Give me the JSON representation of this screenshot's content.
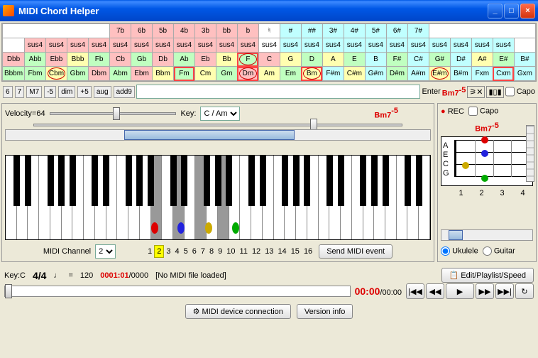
{
  "window": {
    "title": "MIDI Chord Helper"
  },
  "accidentals": [
    "7b",
    "6b",
    "5b",
    "4b",
    "3b",
    "bb",
    "b",
    "♮",
    "#",
    "##",
    "3#",
    "4#",
    "5#",
    "6#",
    "7#"
  ],
  "sus4_row": [
    "sus4",
    "sus4",
    "sus4",
    "sus4",
    "sus4",
    "sus4",
    "sus4",
    "sus4",
    "sus4",
    "sus4",
    "sus4",
    "sus4",
    "sus4",
    "sus4",
    "sus4",
    "sus4",
    "sus4",
    "sus4",
    "sus4",
    "sus4",
    "sus4",
    "sus4",
    "sus4"
  ],
  "major_row": [
    "Dbb",
    "Abb",
    "Ebb",
    "Bbb",
    "Fb",
    "Cb",
    "Gb",
    "Db",
    "Ab",
    "Eb",
    "Bb",
    "F",
    "C",
    "G",
    "D",
    "A",
    "E",
    "B",
    "F#",
    "C#",
    "G#",
    "D#",
    "A#",
    "E#",
    "B#"
  ],
  "minor_row": [
    "Bbbm",
    "Fbm",
    "Cbm",
    "Gbm",
    "Dbm",
    "Abm",
    "Ebm",
    "Bbm",
    "Fm",
    "Cm",
    "Gm",
    "Dm",
    "Am",
    "Em",
    "Bm",
    "F#m",
    "C#m",
    "G#m",
    "D#m",
    "A#m",
    "E#m",
    "B#m",
    "Fxm",
    "Cxm",
    "Gxm"
  ],
  "suffixes": [
    "6",
    "7",
    "M7",
    "-5",
    "dim",
    "+5",
    "aug",
    "add9"
  ],
  "enter_label": "Enter",
  "chord_display": "Bm7",
  "chord_sup": "-5",
  "capo_label": "Capo",
  "velocity": {
    "label": "Velocity=64"
  },
  "key": {
    "label": "Key:",
    "value": "C / Am"
  },
  "rec_label": "REC",
  "fret": {
    "strings": [
      "A",
      "E",
      "C",
      "G"
    ],
    "frets": [
      "1",
      "2",
      "3",
      "4"
    ]
  },
  "instrument": {
    "ukulele": "Ukulele",
    "guitar": "Guitar"
  },
  "midi_channel": {
    "label": "MIDI Channel",
    "value": "2",
    "nums": [
      "1",
      "2",
      "3",
      "4",
      "5",
      "6",
      "7",
      "8",
      "9",
      "10",
      "11",
      "12",
      "13",
      "14",
      "15",
      "16"
    ],
    "send": "Send MIDI event"
  },
  "playback": {
    "key": "Key:C",
    "sig": "4/4",
    "tempo_note": "♩",
    "tempo_eq": "=",
    "tempo": "120",
    "pos": "0001:01",
    "total": "/0000",
    "status": "[No MIDI file loaded]",
    "time": "00:00",
    "time_total": "/00:00"
  },
  "edit_btn": "Edit/Playlist/Speed",
  "midi_conn": "MIDI device connection",
  "version": "Version info"
}
